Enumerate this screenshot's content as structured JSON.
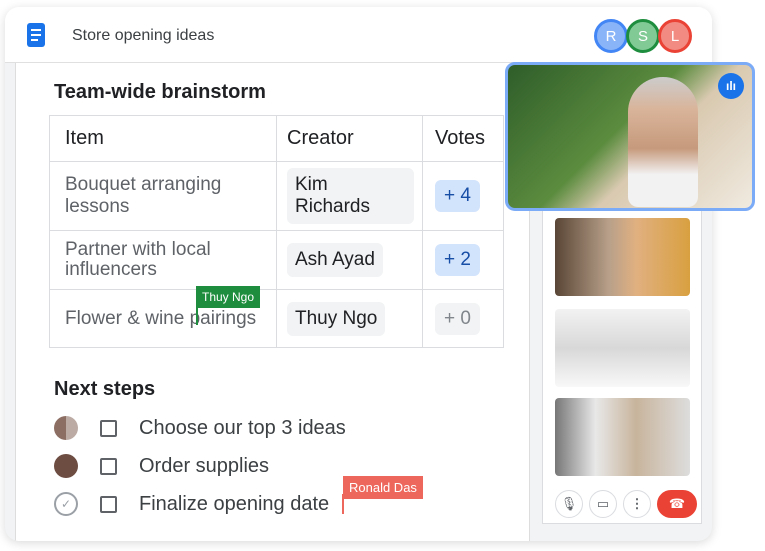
{
  "header": {
    "title": "Store opening ideas",
    "avatars": [
      {
        "letter": "R",
        "color": "#8ab4f8"
      },
      {
        "letter": "S",
        "color": "#34a853"
      },
      {
        "letter": "L",
        "color": "#f28b82"
      }
    ]
  },
  "doc": {
    "section_title": "Team-wide brainstorm",
    "table": {
      "headers": [
        "Item",
        "Creator",
        "Votes"
      ],
      "rows": [
        {
          "item": "Bouquet arranging lessons",
          "creator": "Kim Richards",
          "votes": "+ 4"
        },
        {
          "item": "Partner with local influencers",
          "creator": "Ash Ayad",
          "votes": "+ 2"
        },
        {
          "item": "Flower & wine pairings",
          "creator": "Thuy Ngo",
          "votes": "+ 0"
        }
      ]
    },
    "cursors": [
      {
        "name": "Thuy Ngo",
        "color": "#1e8e3e"
      },
      {
        "name": "Ronald Das",
        "color": "#ee675c"
      }
    ],
    "next_steps_title": "Next steps",
    "steps": [
      {
        "label": "Choose our top 3 ideas",
        "checked": false
      },
      {
        "label": "Order supplies",
        "checked": false
      },
      {
        "label": "Finalize opening date",
        "checked": false
      }
    ]
  },
  "meet": {
    "controls": [
      "mic-icon",
      "camera-icon",
      "more-vert-icon",
      "hang-up-icon"
    ],
    "speaking_indicator": "audio-bars-icon"
  }
}
